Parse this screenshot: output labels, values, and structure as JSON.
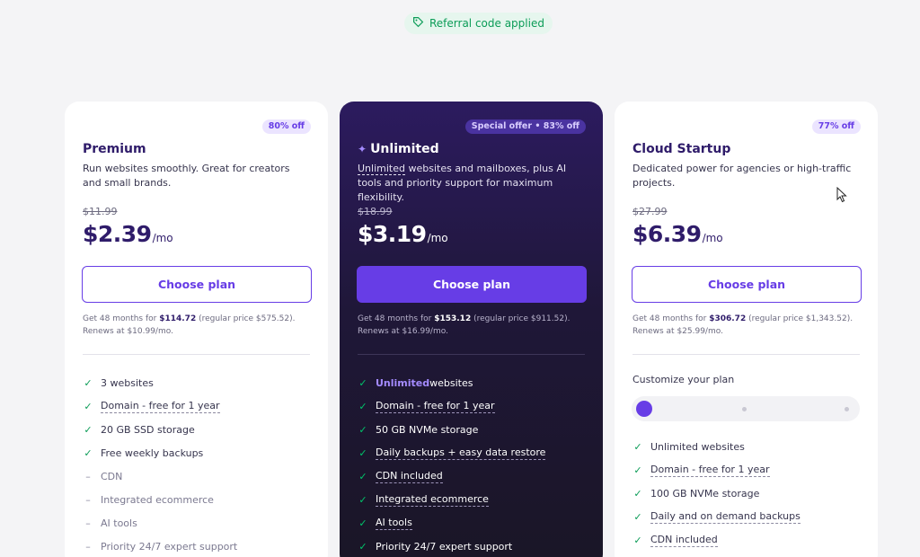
{
  "referral": {
    "text": "Referral code applied",
    "icon": "tag-icon",
    "color": "#0b9c57"
  },
  "colors": {
    "accent": "#673de6",
    "check": "#0b9c57"
  },
  "plans": [
    {
      "badge": "80% off",
      "name": "Premium",
      "description": "Run websites smoothly. Great for creators and small brands.",
      "old_price": "$11.99",
      "price": "$2.39",
      "per": "/mo",
      "button": "Choose plan",
      "note_prefix": "Get 48 months for ",
      "note_total": "$114.72",
      "note_suffix": " (regular price $575.52). Renews at $10.99/mo.",
      "features": [
        {
          "label": "3 websites"
        },
        {
          "label": "Domain - free for 1 year"
        },
        {
          "label": "20 GB SSD storage"
        },
        {
          "label": "Free weekly backups"
        },
        {
          "label": "CDN"
        },
        {
          "label": "Integrated ecommerce"
        },
        {
          "label": "AI tools"
        },
        {
          "label": "Priority 24/7 expert support"
        }
      ]
    },
    {
      "badge": "Special offer • 83% off",
      "name": "Unlimited",
      "description_highlight": "Unlimited",
      "description_rest": " websites and mailboxes, plus AI tools and priority support for maximum flexibility.",
      "old_price": "$18.99",
      "price": "$3.19",
      "per": "/mo",
      "button": "Choose plan",
      "note_prefix": "Get 48 months for ",
      "note_total": "$153.12",
      "note_suffix": " (regular price $911.52). Renews at $16.99/mo.",
      "features": [
        {
          "highlight": "Unlimited",
          "label": " websites"
        },
        {
          "label": "Domain - free for 1 year"
        },
        {
          "label": "50 GB NVMe storage"
        },
        {
          "label": "Daily backups + easy data restore"
        },
        {
          "label": "CDN included"
        },
        {
          "label": "Integrated ecommerce"
        },
        {
          "label": "AI tools"
        },
        {
          "label": "Priority 24/7 expert support"
        }
      ]
    },
    {
      "badge": "77% off",
      "name": "Cloud Startup",
      "description": "Dedicated power for agencies or high-traffic projects.",
      "old_price": "$27.99",
      "price": "$6.39",
      "per": "/mo",
      "button": "Choose plan",
      "note_prefix": "Get 48 months for ",
      "note_total": "$306.72",
      "note_suffix": " (regular price $1,343.52). Renews at $25.99/mo.",
      "customize_label": "Customize your plan",
      "features": [
        {
          "label": "Unlimited websites"
        },
        {
          "label": "Domain - free for 1 year"
        },
        {
          "label": "100 GB NVMe storage"
        },
        {
          "label": "Daily and on demand backups"
        },
        {
          "label": "CDN included"
        }
      ]
    }
  ]
}
